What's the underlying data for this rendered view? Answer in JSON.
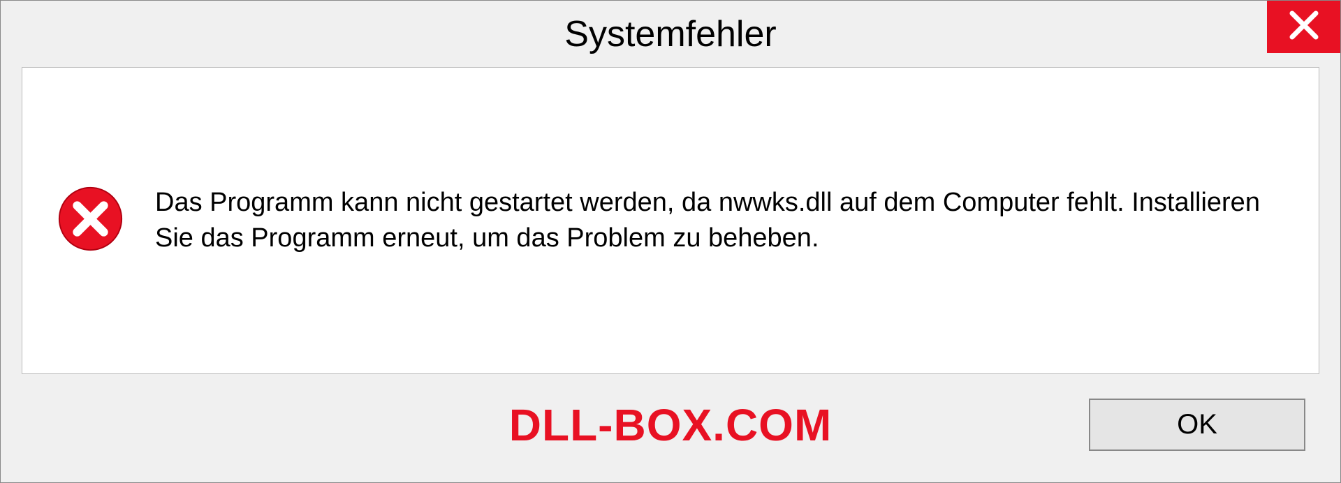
{
  "dialog": {
    "title": "Systemfehler",
    "message": "Das Programm kann nicht gestartet werden, da nwwks.dll auf dem Computer fehlt. Installieren Sie das Programm erneut, um das Problem zu beheben.",
    "ok_label": "OK"
  },
  "watermark": "DLL-BOX.COM"
}
